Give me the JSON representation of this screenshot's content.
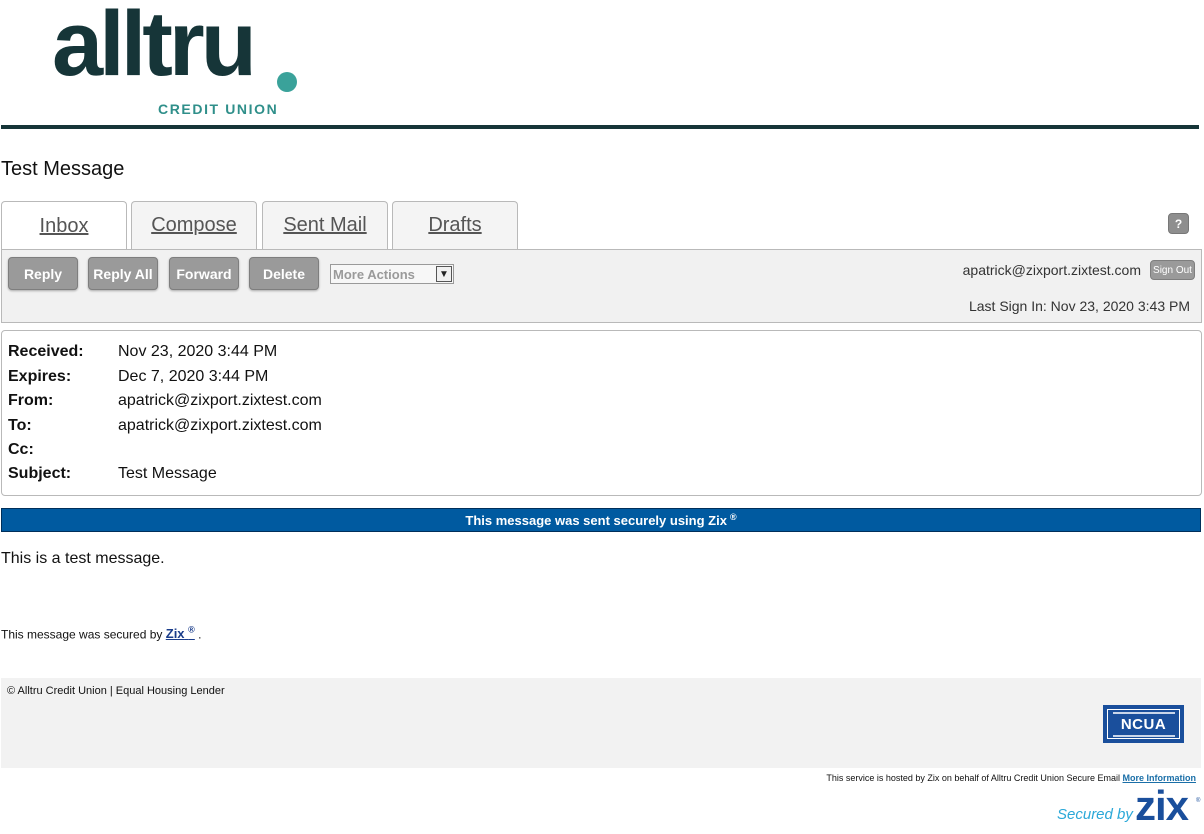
{
  "brand": {
    "logo_word": "alltru",
    "logo_sub": "CREDIT UNION",
    "colors": {
      "primary": "#163538",
      "accent": "#3aa29a",
      "secure_bar": "#005aa0"
    }
  },
  "page_title": "Test Message",
  "tabs": [
    {
      "label": "Inbox"
    },
    {
      "label": "Compose"
    },
    {
      "label": "Sent Mail"
    },
    {
      "label": "Drafts"
    }
  ],
  "help": {
    "label": "?"
  },
  "toolbar": {
    "reply": "Reply",
    "reply_all": "Reply All",
    "forward": "Forward",
    "delete": "Delete",
    "more_actions": "More Actions",
    "user_email": "apatrick@zixport.zixtest.com",
    "sign_out": "Sign Out",
    "last_sign_in": "Last Sign In: Nov 23, 2020 3:43 PM"
  },
  "message": {
    "labels": {
      "received": "Received:",
      "expires": "Expires:",
      "from": "From:",
      "to": "To:",
      "cc": "Cc:",
      "subject": "Subject:"
    },
    "received": "Nov 23, 2020 3:44 PM",
    "expires": "Dec 7, 2020 3:44 PM",
    "from": "apatrick@zixport.zixtest.com",
    "to": "apatrick@zixport.zixtest.com",
    "cc": "",
    "subject": "Test Message",
    "secure_banner": "This message was sent securely using Zix",
    "registered": "®",
    "body": "This is a test message.",
    "secured_prefix": "This message was secured by",
    "secured_link": "Zix",
    "secured_suffix": "."
  },
  "footer": {
    "copyright": "© Alltru Credit Union | Equal Housing Lender",
    "ncua_label": "NCUA",
    "hosted_text": "This service is hosted by Zix on behalf of Alltru Credit Union Secure Email",
    "more_info": "More Information",
    "secured_by": "Secured by",
    "zix_logo": "zix"
  }
}
